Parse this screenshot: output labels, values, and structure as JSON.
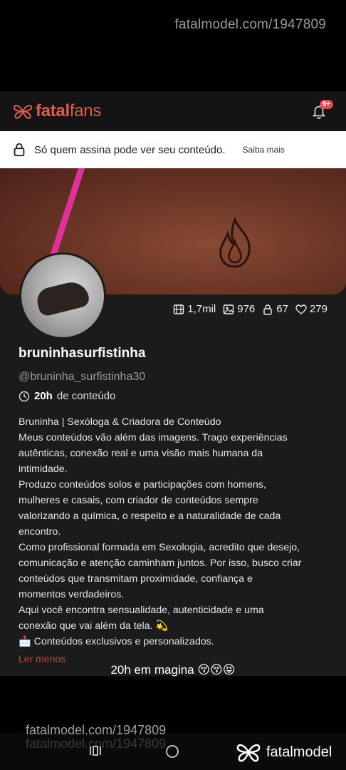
{
  "watermark": {
    "top": "fatalmodel.com/1947809",
    "bottom": "fatalmodel.com/1947809",
    "bottom_ghost": "fatalmodel.com/1947809"
  },
  "header": {
    "logo_bold": "fatal",
    "logo_light": "fans",
    "notification_badge": "9+"
  },
  "notice": {
    "text": "Só quem assina pode ver seu conteúdo.",
    "link": "Saiba mais"
  },
  "stats": {
    "videos": "1,7mil",
    "photos": "976",
    "locked": "67",
    "likes": "279"
  },
  "profile": {
    "username": "bruninhasurfistinha",
    "handle": "@bruninha_surfistinha30",
    "time_value": "20h",
    "time_label": "de conteúdo"
  },
  "bio": [
    "Bruninha | Sexóloga & Criadora de Conteúdo",
    "Meus conteúdos vão além das imagens. Trago experiências",
    "autênticas, conexão real e uma visão mais humana da",
    "intimidade.",
    "Produzo conteúdos solos e participações com homens,",
    "mulheres e casais, com criador de conteúdos sempre",
    "valorizando a química, o respeito e a naturalidade de cada",
    "encontro.",
    "Como profissional formada em Sexologia, acredito que desejo,",
    "comunicação e atenção caminham juntos. Por isso, busco criar",
    "conteúdos que transmitam proximidade, confiança e",
    "momentos verdadeiros.",
    "Aqui você encontra sensualidade, autenticidade e uma",
    "conexão que vai além da tela. 💫",
    "📩 Conteúdos exclusivos e personalizados."
  ],
  "read_less": "Ler menos",
  "caption": "20h em magina 😚😚😝",
  "brand_bottom": "fatalmodel",
  "colors": {
    "accent": "#e05a4e",
    "badge": "#e04a55",
    "background": "#1b1b1b"
  }
}
